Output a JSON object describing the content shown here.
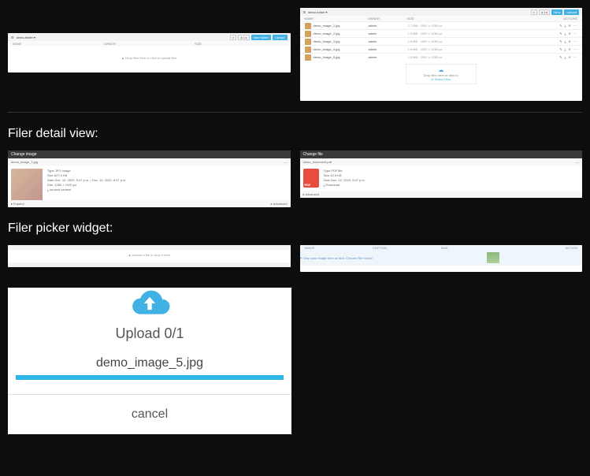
{
  "top_left": {
    "breadcrumb": "demo-folder ▾",
    "btn_new": "New folder",
    "btn_upload": "Upload",
    "col1": "NAME",
    "col2": "OWNER",
    "col3": "SIZE",
    "dropmsg": "▲ Drop files here or click to upload files"
  },
  "top_right": {
    "breadcrumb": "demo-folder ▾",
    "col1": "NAME",
    "col2": "OWNER",
    "col3": "SIZE",
    "col4": "ACTIONS",
    "rows": [
      {
        "name": "demo_image_1.jpg",
        "owner": "admin",
        "size": "1.7 MB · 1920 × 1280 px",
        "actions": "✎ ⤓ ✕ ⋯"
      },
      {
        "name": "demo_image_2.jpg",
        "owner": "admin",
        "size": "1.5 MB · 1920 × 1280 px",
        "actions": "✎ ⤓ ✕ ⋯"
      },
      {
        "name": "demo_image_3.jpg",
        "owner": "admin",
        "size": "1.8 MB · 1920 × 1280 px",
        "actions": "✎ ⤓ ✕ ⋯"
      },
      {
        "name": "demo_image_4.jpg",
        "owner": "admin",
        "size": "1.6 MB · 1920 × 1280 px",
        "actions": "✎ ⤓ ✕ ⋯"
      },
      {
        "name": "demo_image_5.jpg",
        "owner": "admin",
        "size": "1.4 MB · 1920 × 1280 px",
        "actions": "✎ ⤓ ✕ ⋯"
      }
    ],
    "upload_msg": "Drop files here or click to",
    "upload_link": "or Select Files"
  },
  "section_detail": "Filer detail view:",
  "detail_left": {
    "title": "Change image",
    "file": "demo_image_1.jpg",
    "expand": "▸ Expand",
    "advanced": "▸ Advanced",
    "meta": {
      "l1": "Type     JPG image",
      "l2": "Size     627.0 KB",
      "l3": "Date     Dec. 10, 2020, 6:47 p.m. / Dec. 10, 2020, 6:47 p.m.",
      "l4": "Dim.     1280 × 1920 px",
      "l5": "⤓ unused content"
    }
  },
  "detail_right": {
    "title": "Change file",
    "file": "demo_document.pdf",
    "advanced": "▸ Advanced",
    "meta": {
      "l1": "Type     PDF file",
      "l2": "Size     42.5 KB",
      "l3": "Date     Dec. 10, 2020, 6:47 p.m.",
      "l4": "⤓ Download"
    }
  },
  "section_picker": "Filer picker widget:",
  "picker_left": {
    "msg": "▲ choose a file or drop it here"
  },
  "picker_right": {
    "col1": "IMAGE",
    "col2": "CAPTION",
    "col3": "SIZE",
    "col4": "ACTION",
    "msg": "✦ Drop your image here or click 'Choose File' below"
  },
  "upload_dialog": {
    "title": "Upload 0/1",
    "filename": "demo_image_5.jpg",
    "cancel": "cancel"
  }
}
